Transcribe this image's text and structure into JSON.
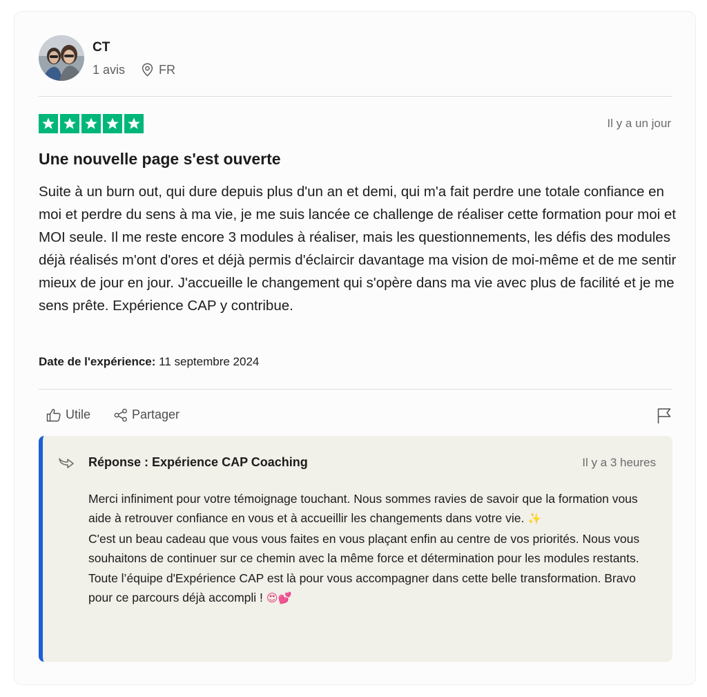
{
  "reviewer": {
    "initials": "CT",
    "reviews_count": "1 avis",
    "country": "FR"
  },
  "rating": {
    "stars": 5,
    "color": "#00b67a"
  },
  "review": {
    "relative_date": "Il y a un jour",
    "title": "Une nouvelle page s'est ouverte",
    "body": "Suite à un burn out, qui dure depuis plus d'un an et demi, qui m'a fait perdre une totale confiance en moi et perdre du sens à ma vie, je me suis lancée ce challenge de réaliser cette formation pour moi et MOI seule. Il me reste encore 3 modules à réaliser, mais les questionnements, les défis des modules déjà réalisés m'ont d'ores et déjà permis d'éclaircir davantage ma vision de moi-même et de me sentir mieux de jour en jour. J'accueille le changement qui s'opère dans ma vie avec plus de facilité et je me sens prête. Expérience CAP y contribue.",
    "experience_date_label": "Date de l'expérience:",
    "experience_date": "11 septembre 2024"
  },
  "actions": {
    "useful_label": "Utile",
    "share_label": "Partager"
  },
  "reply": {
    "title": "Réponse : Expérience CAP Coaching",
    "relative_date": "Il y a 3 heures",
    "paragraph1": "Merci infiniment pour votre témoignage touchant. Nous sommes ravies de savoir que la formation vous aide à retrouver confiance en vous et à accueillir les changements dans votre vie.",
    "emoji1": "✨",
    "paragraph2": "C'est un beau cadeau que vous vous faites en vous plaçant enfin au centre de vos priorités. Nous vous souhaitons de continuer sur ce chemin avec la même force et détermination pour les modules restants. Toute l’équipe d'Expérience CAP est là pour vous accompagner dans cette belle transformation. Bravo pour ce parcours déjà accompli !",
    "emoji2": "😍💕",
    "accent_color": "#1a5fd6",
    "background_color": "#f1f0e9"
  },
  "icons": {
    "location": "location-pin-icon",
    "star": "star-icon",
    "useful": "thumbs-up-icon",
    "share": "share-icon",
    "report": "flag-icon",
    "reply": "reply-arrow-icon"
  }
}
